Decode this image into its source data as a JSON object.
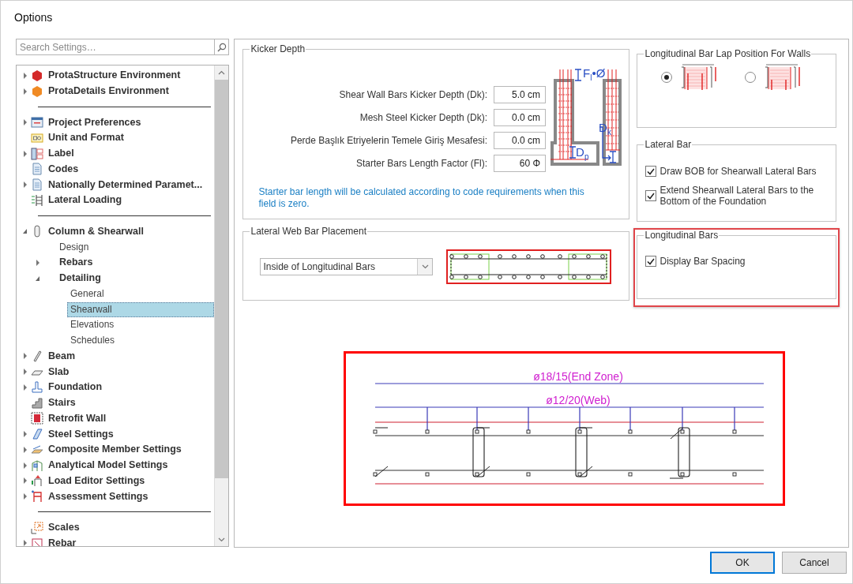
{
  "window": {
    "title": "Options"
  },
  "search": {
    "placeholder": "Search Settings…"
  },
  "tree": {
    "items": [
      {
        "label": "ProtaStructure Environment",
        "expanded": false,
        "selected": false
      },
      {
        "label": "ProtaDetails Environment",
        "expanded": false,
        "selected": false
      },
      {
        "kind": "separator"
      },
      {
        "label": "Project Preferences",
        "expanded": false,
        "selected": false
      },
      {
        "label": "Unit and Format",
        "selected": false
      },
      {
        "label": "Label",
        "expanded": false,
        "selected": false
      },
      {
        "label": "Codes",
        "selected": false
      },
      {
        "label": "Nationally Determined Paramet...",
        "expanded": false,
        "selected": false
      },
      {
        "label": "Lateral Loading",
        "selected": false
      },
      {
        "kind": "separator"
      },
      {
        "label": "Column & Shearwall",
        "expanded": true,
        "selected": false,
        "children": [
          {
            "label": "Design",
            "selected": false
          },
          {
            "label": "Rebars",
            "expanded": false,
            "selected": false
          },
          {
            "label": "Detailing",
            "expanded": true,
            "selected": false,
            "children": [
              {
                "label": "General",
                "selected": false
              },
              {
                "label": "Shearwall",
                "selected": true
              },
              {
                "label": "Elevations",
                "selected": false
              },
              {
                "label": "Schedules",
                "selected": false
              }
            ]
          }
        ]
      },
      {
        "label": "Beam",
        "expanded": false,
        "selected": false
      },
      {
        "label": "Slab",
        "expanded": false,
        "selected": false
      },
      {
        "label": "Foundation",
        "expanded": false,
        "selected": false
      },
      {
        "label": "Stairs",
        "selected": false
      },
      {
        "label": "Retrofit Wall",
        "selected": false
      },
      {
        "label": "Steel Settings",
        "expanded": false,
        "selected": false
      },
      {
        "label": "Composite Member Settings",
        "expanded": false,
        "selected": false
      },
      {
        "label": "Analytical Model Settings",
        "expanded": false,
        "selected": false
      },
      {
        "label": "Load Editor Settings",
        "expanded": false,
        "selected": false
      },
      {
        "label": "Assessment Settings",
        "expanded": false,
        "selected": false
      },
      {
        "kind": "separator"
      },
      {
        "label": "Scales",
        "selected": false
      },
      {
        "label": "Rebar",
        "expanded": false,
        "selected": false
      }
    ]
  },
  "kicker_depth": {
    "title": "Kicker Depth",
    "fields": [
      {
        "label": "Shear Wall Bars Kicker Depth (Dk):",
        "value": "5.0 cm"
      },
      {
        "label": "Mesh Steel Kicker Depth (Dk):",
        "value": "0.0 cm"
      },
      {
        "label": "Perde Başlık Etriyelerin Temele Giriş Mesafesi:",
        "value": "0.0 cm"
      },
      {
        "label": "Starter Bars Length Factor (Fl):",
        "value": "60 Φ"
      }
    ],
    "diagram_labels": [
      "F$_{l}$•Ø",
      "D$_{k}$",
      "D$_{p}$"
    ],
    "note": "Starter bar length will be calculated according to code requirements when this field is zero."
  },
  "lateral_web_bar_placement": {
    "title": "Lateral Web Bar Placement",
    "dropdown": {
      "value": "Inside of Longitudinal Bars"
    }
  },
  "lap_position": {
    "title": "Longitudinal Bar Lap Position For Walls",
    "options": [
      {
        "selected": true
      },
      {
        "selected": false
      }
    ]
  },
  "lateral_bar": {
    "title": "Lateral Bar",
    "options": [
      {
        "label": "Draw BOB for Shearwall Lateral Bars",
        "checked": true
      },
      {
        "label": "Extend Shearwall Lateral Bars to the Bottom of the Foundation",
        "checked": true
      }
    ]
  },
  "longitudinal_bars": {
    "title": "Longitudinal Bars",
    "highlighted": true,
    "options": [
      {
        "label": "Display Bar Spacing",
        "checked": true
      }
    ]
  },
  "preview": {
    "labels": [
      "ø18/15(End Zone)",
      "ø12/20(Web)"
    ]
  },
  "buttons": [
    {
      "label": "OK",
      "default": true
    },
    {
      "label": "Cancel",
      "default": false
    }
  ]
}
